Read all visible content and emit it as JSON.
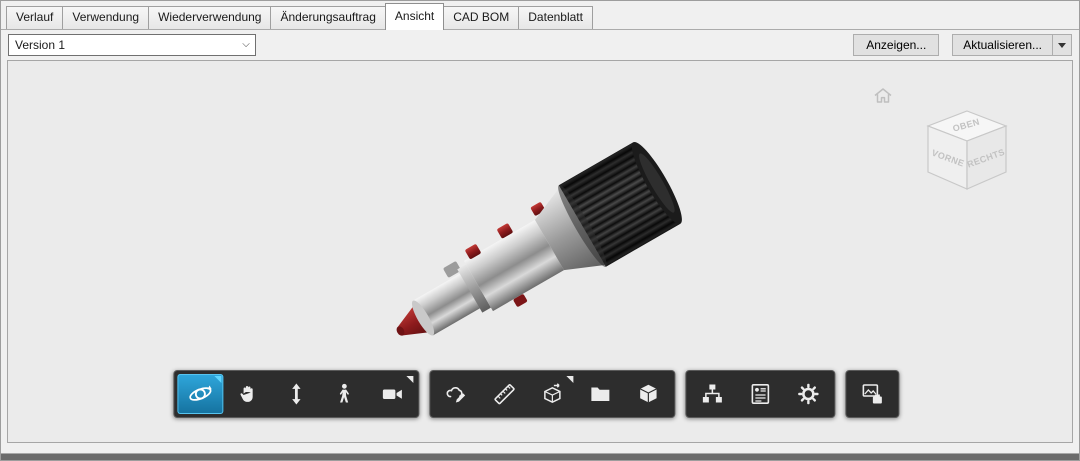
{
  "tabs": [
    {
      "label": "Verlauf",
      "active": false
    },
    {
      "label": "Verwendung",
      "active": false
    },
    {
      "label": "Wiederverwendung",
      "active": false
    },
    {
      "label": "Änderungsauftrag",
      "active": false
    },
    {
      "label": "Ansicht",
      "active": true
    },
    {
      "label": "CAD BOM",
      "active": false
    },
    {
      "label": "Datenblatt",
      "active": false
    }
  ],
  "version_bar": {
    "version_select": {
      "value": "Version 1"
    },
    "anzeigen_button": "Anzeigen...",
    "aktualisieren_button": "Aktualisieren..."
  },
  "viewer": {
    "viewcube": {
      "top": "OBEN",
      "front": "VORNE",
      "right": "RECHTS"
    },
    "toolbar": {
      "navigation_group": [
        "orbit",
        "pan",
        "zoom-vertical",
        "walk",
        "camera"
      ],
      "tools_group": [
        "markup",
        "measure",
        "section-box",
        "folder",
        "model-cube"
      ],
      "panels_group": [
        "model-structure",
        "properties",
        "settings"
      ],
      "output_group": [
        "snapshot"
      ],
      "active_tool": "orbit"
    }
  },
  "colors": {
    "active_tool_bg": "#1d89bf",
    "viewer_toolbar_bg": "#2d2d2d",
    "viewport_bg": "#ebebeb",
    "tab_active_bg": "#ffffff"
  }
}
